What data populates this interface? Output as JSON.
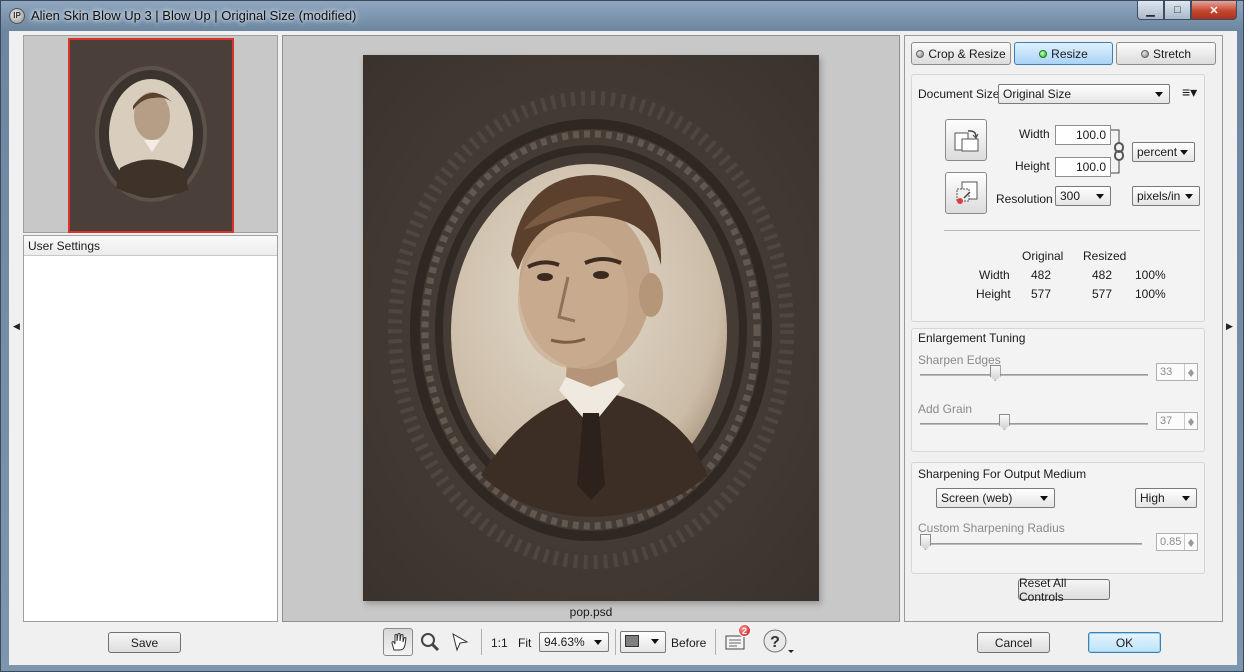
{
  "window": {
    "title": "Alien Skin Blow Up 3 | Blow Up | Original Size (modified)",
    "app_icon_text": "IP",
    "minimize_icon": "minimize-icon",
    "maximize_icon": "maximize-icon",
    "close_icon": "close-icon"
  },
  "left_panel": {
    "settings_header": "User Settings"
  },
  "preview": {
    "filename": "pop.psd"
  },
  "mode_tabs": [
    {
      "label": "Crop & Resize",
      "active": false
    },
    {
      "label": "Resize",
      "active": true
    },
    {
      "label": "Stretch",
      "active": false
    }
  ],
  "document": {
    "size_label": "Document Size",
    "size_value": "Original Size",
    "width_label": "Width",
    "width_value": "100.0",
    "height_label": "Height",
    "height_value": "100.0",
    "unit_value": "percent",
    "resolution_label": "Resolution",
    "resolution_value": "300",
    "resolution_unit": "pixels/in"
  },
  "size_table": {
    "col_original": "Original",
    "col_resized": "Resized",
    "rows": [
      {
        "label": "Width",
        "original": "482",
        "resized": "482",
        "percent": "100%"
      },
      {
        "label": "Height",
        "original": "577",
        "resized": "577",
        "percent": "100%"
      }
    ]
  },
  "enlargement": {
    "title": "Enlargement Tuning",
    "sharpen_label": "Sharpen Edges",
    "sharpen_value": "33",
    "sharpen_fraction": 0.33,
    "grain_label": "Add Grain",
    "grain_value": "37",
    "grain_fraction": 0.37
  },
  "output_sharpening": {
    "title": "Sharpening For Output Medium",
    "medium_value": "Screen (web)",
    "level_value": "High",
    "radius_label": "Custom Sharpening Radius",
    "radius_value": "0.85"
  },
  "reset_label": "Reset All Controls",
  "bottom": {
    "save_label": "Save",
    "zoom_1to1": "1:1",
    "fit_label": "Fit",
    "zoom_value": "94.63%",
    "before_label": "Before",
    "messages_count": "2",
    "cancel_label": "Cancel",
    "ok_label": "OK"
  }
}
